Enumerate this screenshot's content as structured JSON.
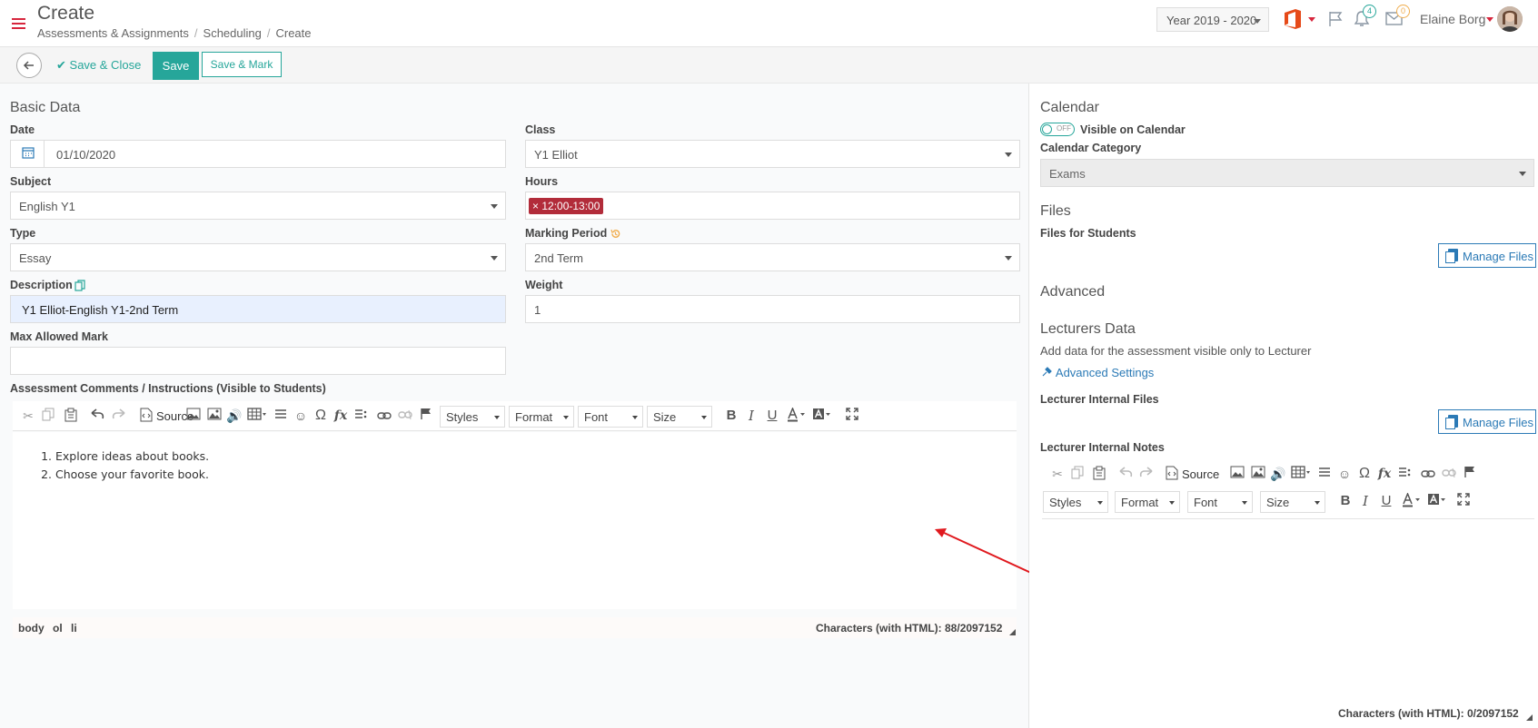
{
  "header": {
    "title": "Create",
    "breadcrumb": [
      "Assessments & Assignments",
      "Scheduling",
      "Create"
    ],
    "year": "Year 2019 - 2020",
    "notifications_count": "4",
    "messages_count": "0",
    "user_name": "Elaine Borg"
  },
  "toolbar": {
    "save_close": "Save & Close",
    "save": "Save",
    "save_mark": "Save & Mark"
  },
  "basic": {
    "heading": "Basic Data",
    "date_label": "Date",
    "date_value": "01/10/2020",
    "class_label": "Class",
    "class_value": "Y1 Elliot",
    "subject_label": "Subject",
    "subject_value": "English Y1",
    "hours_label": "Hours",
    "hours_value": "12:00-13:00",
    "type_label": "Type",
    "type_value": "Essay",
    "marking_label": "Marking Period",
    "marking_value": "2nd Term",
    "desc_label": "Description",
    "desc_value": "Y1 Elliot-English Y1-2nd Term",
    "weight_label": "Weight",
    "weight_value": "1",
    "max_label": "Max Allowed Mark",
    "max_value": "",
    "comments_label": "Assessment Comments / Instructions (Visible to Students)"
  },
  "editor": {
    "source": "Source",
    "styles": "Styles",
    "format": "Format",
    "font": "Font",
    "size": "Size",
    "bold": "B",
    "italic": "I",
    "underline": "U",
    "items": [
      "Explore ideas about books.",
      "Choose your favorite book."
    ],
    "path": [
      "body",
      "ol",
      "li"
    ],
    "chars": "Characters (with HTML): 88/2097152"
  },
  "side": {
    "calendar_heading": "Calendar",
    "toggle_state": "OFF",
    "visible_label": "Visible on Calendar",
    "cal_cat_label": "Calendar Category",
    "cal_cat_value": "Exams",
    "files_heading": "Files",
    "files_students_label": "Files for Students",
    "manage_files": "Manage Files",
    "advanced_heading": "Advanced",
    "lecturers_heading": "Lecturers Data",
    "lecturers_desc": "Add data for the assessment visible only to Lecturer",
    "advanced_settings": "Advanced Settings",
    "internal_files_label": "Lecturer Internal Files",
    "internal_notes_label": "Lecturer Internal Notes",
    "notes_chars": "Characters (with HTML): 0/2097152"
  },
  "colors": {
    "accent": "#26a69a",
    "brand_red": "#d7263d",
    "link_blue": "#2b7ab6",
    "arrow_red": "#e0191e"
  }
}
